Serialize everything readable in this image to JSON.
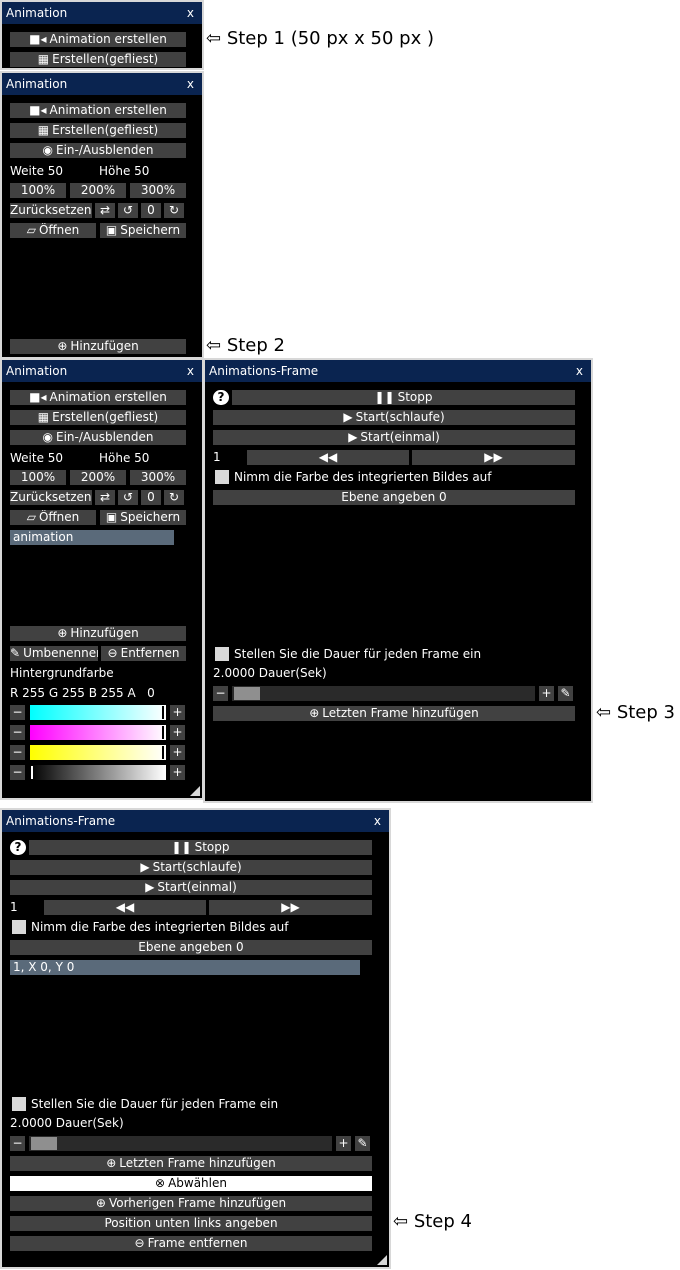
{
  "p1": {
    "title": "Animation",
    "close": "x",
    "create": "Animation erstellen",
    "tiled": "Erstellen(gefliest)"
  },
  "p2": {
    "title": "Animation",
    "close": "x",
    "create": "Animation erstellen",
    "tiled": "Erstellen(gefliest)",
    "toggle": "Ein-/Ausblenden",
    "width": "Weite 50",
    "height": "Höhe 50",
    "z100": "100%",
    "z200": "200%",
    "z300": "300%",
    "reset": "Zurücksetzen",
    "rot_value": "0",
    "open": "Öffnen",
    "save": "Speichern",
    "add": "Hinzufügen"
  },
  "p3": {
    "title": "Animation",
    "close": "x",
    "create": "Animation erstellen",
    "tiled": "Erstellen(gefliest)",
    "toggle": "Ein-/Ausblenden",
    "width": "Weite 50",
    "height": "Höhe 50",
    "z100": "100%",
    "z200": "200%",
    "z300": "300%",
    "reset": "Zurücksetzen",
    "rot_value": "0",
    "open": "Öffnen",
    "save": "Speichern",
    "list_item": "animation",
    "add": "Hinzufügen",
    "rename": "Umbenennen",
    "remove": "Entfernen",
    "bg_label": "Hintergrundfarbe",
    "rgba": "R 255 G 255 B 255 A   0",
    "minus": "−",
    "plus": "+"
  },
  "p4": {
    "title": "Animations-Frame",
    "close": "x",
    "help": "?",
    "stop": "Stopp",
    "start_loop": "Start(schlaufe)",
    "start_once": "Start(einmal)",
    "frame_no": "1",
    "pick_color": "Nimm die Farbe des integrierten Bildes auf",
    "layer": "Ebene angeben 0",
    "set_duration": "Stellen Sie die Dauer für jeden Frame ein",
    "duration": "2.0000 Dauer(Sek)",
    "minus": "−",
    "plus": "+",
    "add_last": "Letzten Frame hinzufügen"
  },
  "p5": {
    "title": "Animations-Frame",
    "close": "x",
    "help": "?",
    "stop": "Stopp",
    "start_loop": "Start(schlaufe)",
    "start_once": "Start(einmal)",
    "frame_no": "1",
    "pick_color": "Nimm die Farbe des integrierten Bildes auf",
    "layer": "Ebene angeben 0",
    "list_item": "1, X 0, Y 0",
    "set_duration": "Stellen Sie die Dauer für jeden Frame ein",
    "duration": "2.0000 Dauer(Sek)",
    "minus": "−",
    "plus": "+",
    "add_last": "Letzten Frame hinzufügen",
    "deselect": "Abwählen",
    "add_prev": "Vorherigen Frame hinzufügen",
    "pos_bottom_left": "Position unten links angeben",
    "remove_frame": "Frame entfernen"
  },
  "notes": {
    "step1": "Step 1 (50 px   x   50 px )",
    "step2": "Step 2",
    "step3": "Step 3",
    "step4": "Step 4",
    "arrow": "⇦"
  },
  "icons": {
    "video": "video-camera-icon",
    "grid": "grid-icon",
    "eye": "eye-icon",
    "swap": "swap-icon",
    "undo": "rotate-left-icon",
    "redo": "rotate-right-icon",
    "folder": "folder-open-icon",
    "floppy": "floppy-disk-icon",
    "plus_circle": "plus-circle-icon",
    "minus_circle": "minus-circle-icon",
    "edit": "edit-icon",
    "pause": "pause-icon",
    "play": "play-icon",
    "rewind": "rewind-icon",
    "fastforward": "fast-forward-icon",
    "question": "question-circle-icon",
    "close_circle": "close-circle-icon"
  },
  "colors": {
    "panel_bg": "#000000",
    "titlebar": "#0a2450",
    "button": "#414141",
    "selected_row": "#5a6a7a",
    "cyan": "#00ffff",
    "magenta": "#ff00ff",
    "yellow": "#ffff00"
  }
}
